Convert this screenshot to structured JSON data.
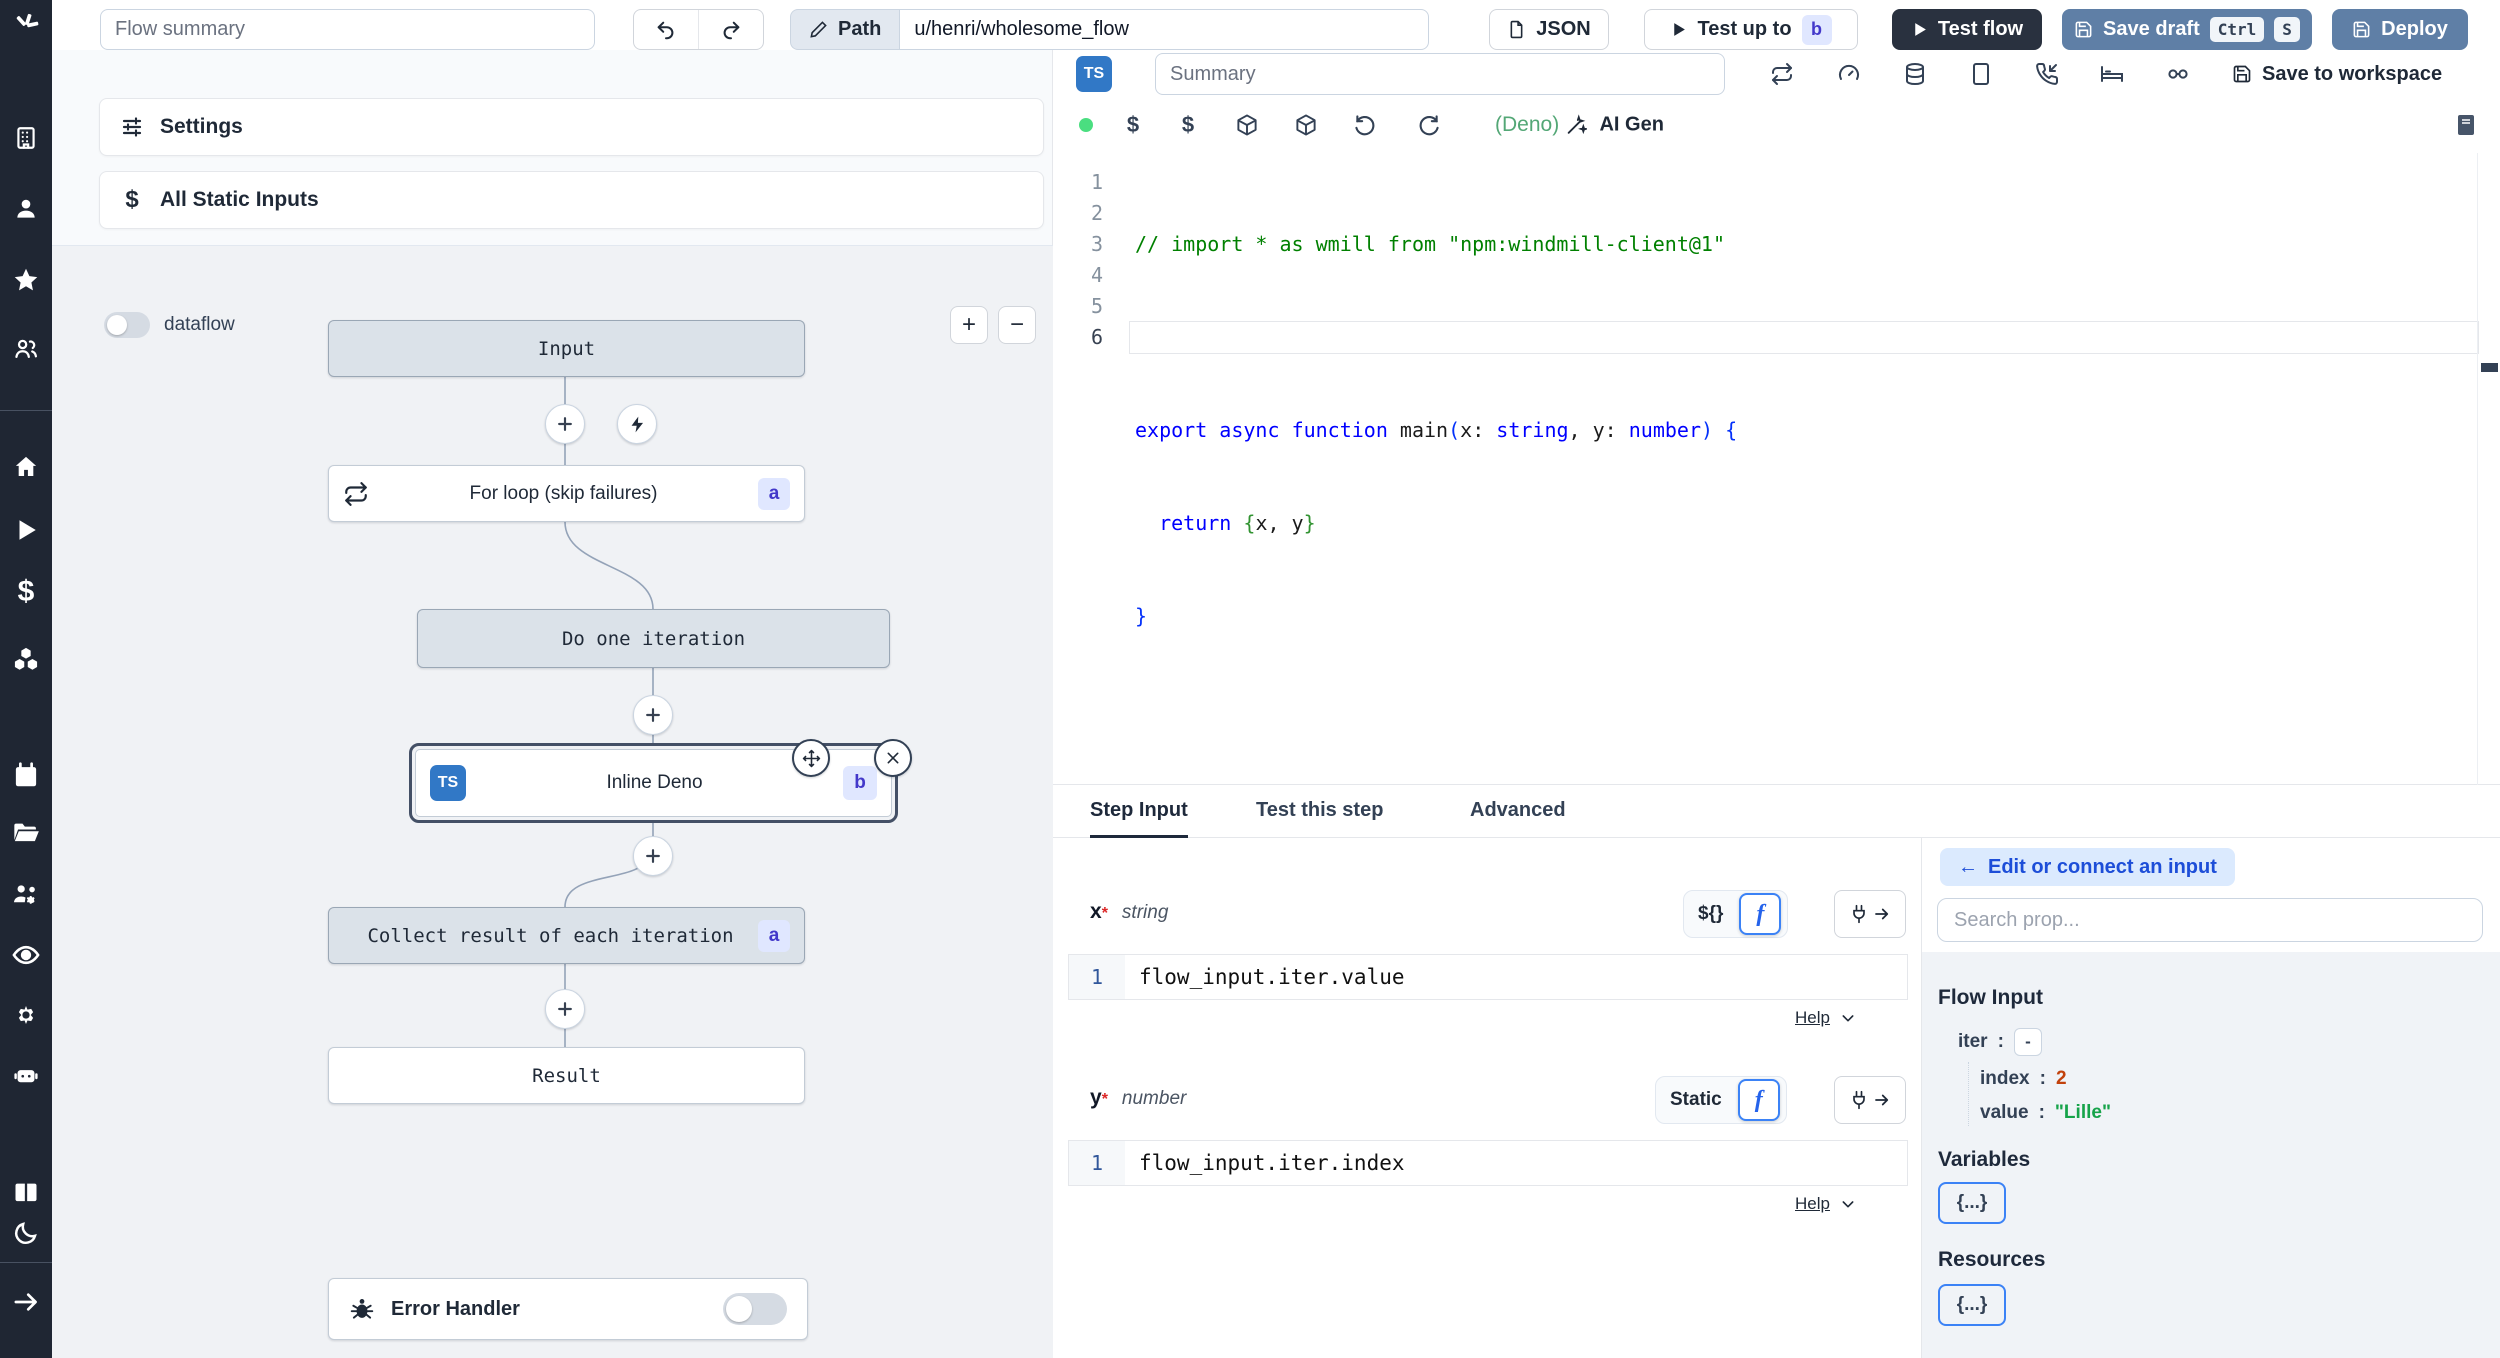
{
  "header": {
    "flow_summary_placeholder": "Flow summary",
    "path_label": "Path",
    "path_value": "u/henri/wholesome_flow",
    "json_button": "JSON",
    "test_up_to": "Test up to",
    "test_up_to_badge": "b",
    "test_flow": "Test flow",
    "save_draft": "Save draft",
    "kbd_ctrl": "Ctrl",
    "kbd_s": "S",
    "deploy": "Deploy"
  },
  "flow_panel": {
    "settings_label": "Settings",
    "all_static_inputs_label": "All Static Inputs",
    "dataflow_label": "dataflow",
    "zoom_in": "+",
    "zoom_out": "−",
    "nodes": {
      "input": "Input",
      "for_loop": "For loop (skip failures)",
      "for_loop_badge": "a",
      "do_one_iteration": "Do one iteration",
      "inline_deno": "Inline Deno",
      "inline_deno_badge": "b",
      "inline_deno_lang": "TS",
      "collect": "Collect result of each iteration",
      "collect_badge": "a",
      "result": "Result"
    },
    "error_handler_label": "Error Handler"
  },
  "editor": {
    "lang_badge": "TS",
    "summary_placeholder": "Summary",
    "save_to_workspace": "Save to workspace",
    "deno_label": "(Deno)",
    "ai_gen_label": "AI Gen",
    "line_numbers": [
      "1",
      "2",
      "3",
      "4",
      "5",
      "6"
    ],
    "code": [
      [
        {
          "t": "// import * as wmill from \"npm:windmill-client@1\"",
          "c": "com"
        }
      ],
      [],
      [
        {
          "t": "export",
          "c": "kw"
        },
        {
          "t": " ",
          "c": "pl"
        },
        {
          "t": "async",
          "c": "kw"
        },
        {
          "t": " ",
          "c": "pl"
        },
        {
          "t": "function",
          "c": "kw"
        },
        {
          "t": " main",
          "c": "pl"
        },
        {
          "t": "(",
          "c": "b1"
        },
        {
          "t": "x",
          "c": "pl"
        },
        {
          "t": ": ",
          "c": "pl"
        },
        {
          "t": "string",
          "c": "kw"
        },
        {
          "t": ", y",
          "c": "pl"
        },
        {
          "t": ": ",
          "c": "pl"
        },
        {
          "t": "number",
          "c": "kw"
        },
        {
          "t": ")",
          "c": "b1"
        },
        {
          "t": " ",
          "c": "pl"
        },
        {
          "t": "{",
          "c": "b1"
        }
      ],
      [
        {
          "t": "  ",
          "c": "pl"
        },
        {
          "t": "return",
          "c": "kw"
        },
        {
          "t": " ",
          "c": "pl"
        },
        {
          "t": "{",
          "c": "b2"
        },
        {
          "t": "x, y",
          "c": "pl"
        },
        {
          "t": "}",
          "c": "b2"
        }
      ],
      [
        {
          "t": "}",
          "c": "b1"
        }
      ],
      []
    ]
  },
  "tabs": {
    "step_input": "Step Input",
    "test_this_step": "Test this step",
    "advanced": "Advanced"
  },
  "step_input": {
    "x": {
      "name": "x",
      "required": "*",
      "type": "string",
      "toggle_left": "${}",
      "line_no": "1",
      "expr": "flow_input.iter.value",
      "help": "Help"
    },
    "y": {
      "name": "y",
      "required": "*",
      "type": "number",
      "toggle_left": "Static",
      "line_no": "1",
      "expr": "flow_input.iter.index",
      "help": "Help"
    }
  },
  "props_panel": {
    "edit_arrow": "←",
    "edit_connect_label": "Edit or connect an input",
    "search_placeholder": "Search prop...",
    "flow_input_title": "Flow Input",
    "tree": {
      "iter_key": "iter",
      "iter_sep": ":",
      "iter_value": "-",
      "index_key": "index",
      "index_sep": ":",
      "index_value": "2",
      "value_key": "value",
      "value_sep": ":",
      "value_value": "\"Lille\""
    },
    "variables_title": "Variables",
    "variables_chip": "{...}",
    "resources_title": "Resources",
    "resources_chip": "{...}"
  },
  "colors": {
    "accent_steel": "#5f7fa6",
    "dark_button": "#29313f",
    "sidebar": "#1f2633",
    "badge_bg": "#e0e7ff",
    "badge_text": "#4338ca",
    "ts_blue": "#3178c6",
    "index_orange": "#c2410c",
    "value_green": "#16a34a",
    "deno_green": "#53a776"
  }
}
